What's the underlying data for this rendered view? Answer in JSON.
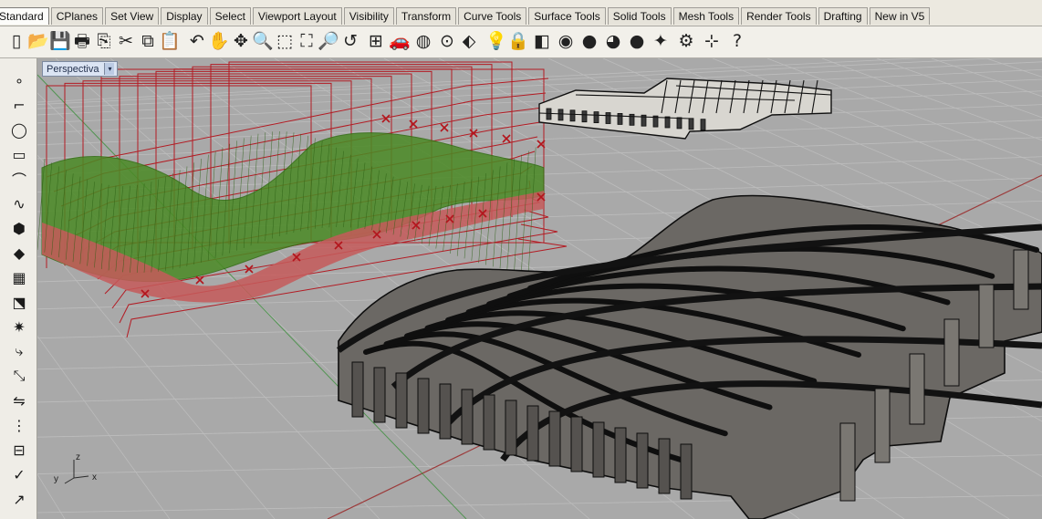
{
  "toolbar_tabs": [
    {
      "label": "Standard",
      "active": true
    },
    {
      "label": "CPlanes"
    },
    {
      "label": "Set View"
    },
    {
      "label": "Display"
    },
    {
      "label": "Select"
    },
    {
      "label": "Viewport Layout"
    },
    {
      "label": "Visibility"
    },
    {
      "label": "Transform"
    },
    {
      "label": "Curve Tools"
    },
    {
      "label": "Surface Tools"
    },
    {
      "label": "Solid Tools"
    },
    {
      "label": "Mesh Tools"
    },
    {
      "label": "Render Tools"
    },
    {
      "label": "Drafting"
    },
    {
      "label": "New in V5"
    }
  ],
  "standard_toolbar": [
    {
      "name": "new-file-icon",
      "glyph": "▯"
    },
    {
      "name": "open-folder-icon",
      "glyph": "📂"
    },
    {
      "name": "save-icon",
      "glyph": "💾"
    },
    {
      "name": "print-icon",
      "glyph": "🖶"
    },
    {
      "name": "export-icon",
      "glyph": "⎘"
    },
    {
      "name": "cut-icon",
      "glyph": "✂"
    },
    {
      "name": "copy-icon",
      "glyph": "⧉"
    },
    {
      "name": "paste-icon",
      "glyph": "📋"
    },
    {
      "name": "undo-icon",
      "glyph": "↶"
    },
    {
      "name": "pan-hand-icon",
      "glyph": "✋"
    },
    {
      "name": "rotate-view-icon",
      "glyph": "✥"
    },
    {
      "name": "zoom-icon",
      "glyph": "🔍"
    },
    {
      "name": "zoom-window-icon",
      "glyph": "⬚"
    },
    {
      "name": "zoom-extents-icon",
      "glyph": "⛶"
    },
    {
      "name": "zoom-selected-icon",
      "glyph": "🔎"
    },
    {
      "name": "undo-view-icon",
      "glyph": "↺"
    },
    {
      "name": "four-viewports-icon",
      "glyph": "⊞"
    },
    {
      "name": "car-icon",
      "glyph": "🚗"
    },
    {
      "name": "toggle-icon",
      "glyph": "◍"
    },
    {
      "name": "circle-icon",
      "glyph": "⊙"
    },
    {
      "name": "select-icon",
      "glyph": "⬖"
    },
    {
      "name": "lightbulb-icon",
      "glyph": "💡"
    },
    {
      "name": "lock-icon",
      "glyph": "🔒"
    },
    {
      "name": "layers-icon",
      "glyph": "◧"
    },
    {
      "name": "color-wheel-icon",
      "glyph": "◉"
    },
    {
      "name": "sphere-render-icon",
      "glyph": "●"
    },
    {
      "name": "sphere-shaded-icon",
      "glyph": "◕"
    },
    {
      "name": "render-icon",
      "glyph": "●"
    },
    {
      "name": "light-icon",
      "glyph": "✦"
    },
    {
      "name": "options-gear-icon",
      "glyph": "⚙"
    },
    {
      "name": "dimension-icon",
      "glyph": "⊹"
    },
    {
      "name": "help-icon",
      "glyph": "?"
    }
  ],
  "left_toolbar": [
    {
      "name": "point-icon",
      "glyph": "∘"
    },
    {
      "name": "polyline-icon",
      "glyph": "⌐"
    },
    {
      "name": "circle-icon",
      "glyph": "◯"
    },
    {
      "name": "rectangle-icon",
      "glyph": "▭"
    },
    {
      "name": "arc-icon",
      "glyph": "⌒"
    },
    {
      "name": "curve-icon",
      "glyph": "∿"
    },
    {
      "name": "solid-icon",
      "glyph": "⬢"
    },
    {
      "name": "surface-icon",
      "glyph": "◆"
    },
    {
      "name": "mesh-icon",
      "glyph": "▦"
    },
    {
      "name": "boolean-icon",
      "glyph": "⬔"
    },
    {
      "name": "explode-icon",
      "glyph": "✷"
    },
    {
      "name": "fillet-icon",
      "glyph": "⤷"
    },
    {
      "name": "transform-icon",
      "glyph": "⤡"
    },
    {
      "name": "mirror-icon",
      "glyph": "⇋"
    },
    {
      "name": "array-icon",
      "glyph": "⋮"
    },
    {
      "name": "split-icon",
      "glyph": "⊟"
    },
    {
      "name": "check-icon",
      "glyph": "✓"
    },
    {
      "name": "dimension-icon",
      "glyph": "↗"
    }
  ],
  "viewport": {
    "title": "Perspectiva",
    "dropdown": "▾",
    "axis_labels": {
      "z": "z",
      "y": "y",
      "x": "x"
    },
    "colors": {
      "background": "#a8a8a8",
      "grid": "#bdbdbd",
      "grid_major": "#c9c9c9",
      "x_axis": "#9c3b3b",
      "y_axis": "#3b8f3b",
      "control_points": "#b3151c",
      "wire_green": "#3a8a1e",
      "wire_red": "#c44b4b",
      "solid_fill": "#6d6a66",
      "solid_edge": "#0e0e0e"
    }
  }
}
